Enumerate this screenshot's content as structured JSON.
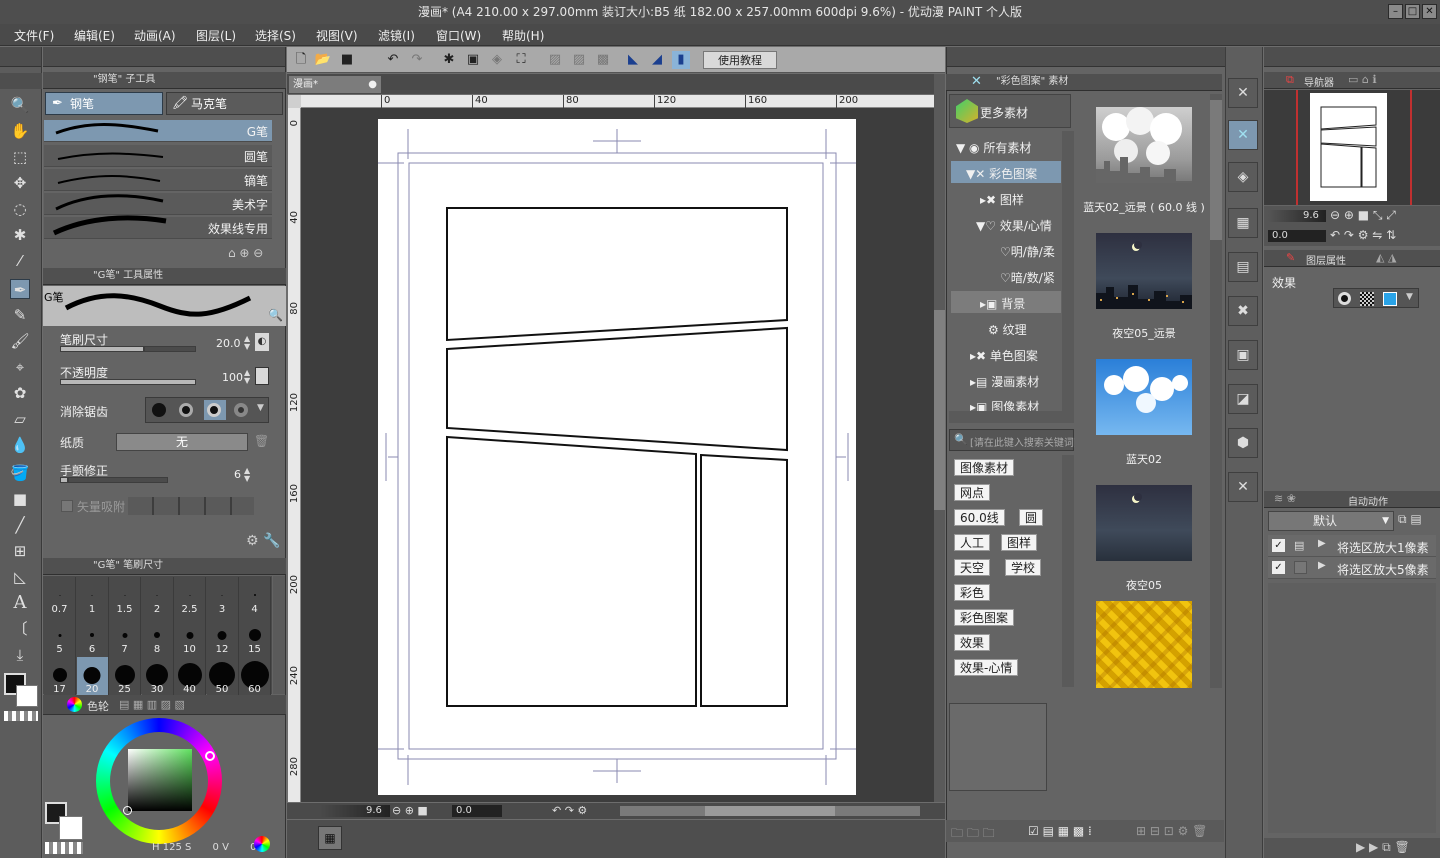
{
  "window": {
    "title": "漫画* (A4 210.00 x 297.00mm 装订大小:B5 纸 182.00 x 257.00mm 600dpi 9.6%) - 优动漫 PAINT 个人版"
  },
  "menu": [
    "文件(F)",
    "编辑(E)",
    "动画(A)",
    "图层(L)",
    "选择(S)",
    "视图(V)",
    "滤镜(I)",
    "窗口(W)",
    "帮助(H)"
  ],
  "toolbar": {
    "tutorial": "使用教程"
  },
  "subtool": {
    "header": "\"钢笔\" 子工具",
    "tabs": [
      "钢笔",
      "马克笔"
    ],
    "brushes": [
      "G笔",
      "圆笔",
      "镝笔",
      "美术字",
      "效果线专用"
    ]
  },
  "toolprops": {
    "header": "\"G笔\" 工具属性",
    "preview_label": "G笔",
    "size_label": "笔刷尺寸",
    "size_value": "20.0",
    "opacity_label": "不透明度",
    "opacity_value": "100",
    "aa_label": "消除锯齿",
    "paper_label": "纸质",
    "paper_value": "无",
    "stab_label": "手颤修正",
    "stab_value": "6",
    "snap_label": "矢量吸附"
  },
  "brushsize": {
    "header": "\"G笔\" 笔刷尺寸",
    "sizes": [
      "0.7",
      "1",
      "1.5",
      "2",
      "2.5",
      "3",
      "4",
      "5",
      "6",
      "7",
      "8",
      "10",
      "12",
      "15",
      "17",
      "20",
      "25",
      "30",
      "40",
      "50",
      "60"
    ]
  },
  "color": {
    "tab": "色轮",
    "h_label": "H",
    "h": "125",
    "s_label": "S",
    "s": "0",
    "v_label": "V",
    "v": "0",
    "fg": "#1b1b1b",
    "bg": "#ffffff",
    "sv_top": "#5fe15f"
  },
  "canvas": {
    "tab": "漫画*",
    "ruler_top": [
      "0",
      "40",
      "80",
      "120",
      "160",
      "200"
    ],
    "ruler_left": [
      "0",
      "40",
      "80",
      "120",
      "160",
      "200",
      "240",
      "280"
    ],
    "zoom": "9.6",
    "angle": "0.0"
  },
  "material": {
    "header": "\"彩色图案\" 素材",
    "more": "更多素材",
    "tree": [
      "所有素材",
      "彩色图案",
      "图样",
      "效果/心情",
      "明/静/柔",
      "暗/数/紧",
      "背景",
      "纹理",
      "单色图案",
      "漫画素材",
      "图像素材"
    ],
    "search_placeholder": "[请在此键入搜索关键词]",
    "tags": [
      "图像素材",
      "网点",
      "60.0线",
      "圆",
      "人工",
      "图样",
      "天空",
      "学校",
      "彩色",
      "彩色图案",
      "效果",
      "效果-心情"
    ],
    "thumbs": [
      "蓝天02_远景 ( 60.0 线 )",
      "夜空05_远景",
      "蓝天02",
      "夜空05"
    ]
  },
  "navigator": {
    "tab": "导航器",
    "zoom": "9.6",
    "angle": "0.0"
  },
  "layer_props": {
    "tab": "图层属性",
    "effect_label": "效果"
  },
  "auto_action": {
    "tab": "自动动作",
    "set": "默认",
    "items": [
      "将选区放大1像素",
      "将选区放大5像素"
    ]
  }
}
